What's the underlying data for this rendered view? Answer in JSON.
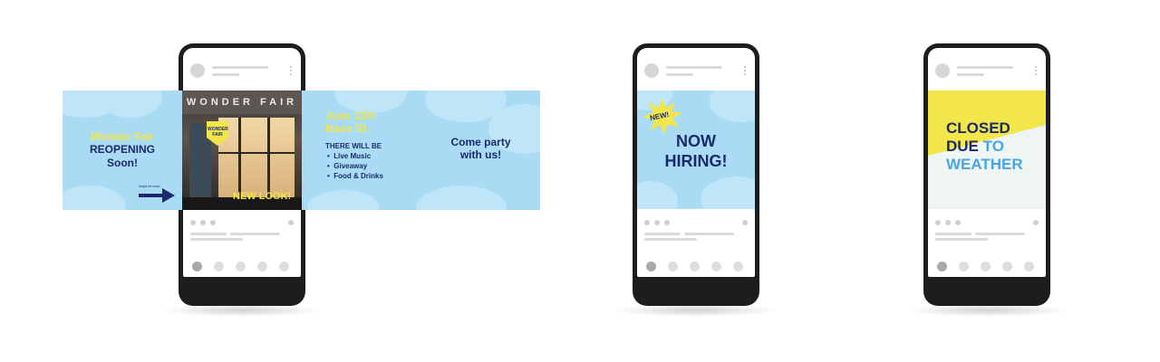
{
  "colors": {
    "navy": "#1b2a6b",
    "yellow": "#f2e64a",
    "sky": "#a9dbf5",
    "cloud": "#bfe5f9",
    "blue_text": "#45a7e6",
    "pale": "#eef5f3"
  },
  "banner": {
    "panel1": {
      "brand": "Wonder Fair",
      "line2": "REOPENING",
      "line3": "Soon!",
      "swipe_hint": "Swipe for more",
      "arrow_icon": "arrow-right-icon"
    },
    "panel2": {
      "sign": "WONDER FAIR",
      "tag": "WONDER FAIR",
      "caption": "NEW LOOK!"
    },
    "panel3": {
      "date": "June 13th",
      "address": "Mass St.",
      "intro": "THERE WILL BE",
      "items": [
        "Live Music",
        "Giveaway",
        "Food & Drinks"
      ]
    },
    "panel4": {
      "line1": "Come party",
      "line2": "with us!"
    }
  },
  "post2": {
    "badge": "NEW!",
    "line1": "NOW",
    "line2": "HIRING!"
  },
  "post3": {
    "line1": "CLOSED",
    "line2a": "DUE",
    "line2b": "TO",
    "line3": "WEATHER"
  }
}
